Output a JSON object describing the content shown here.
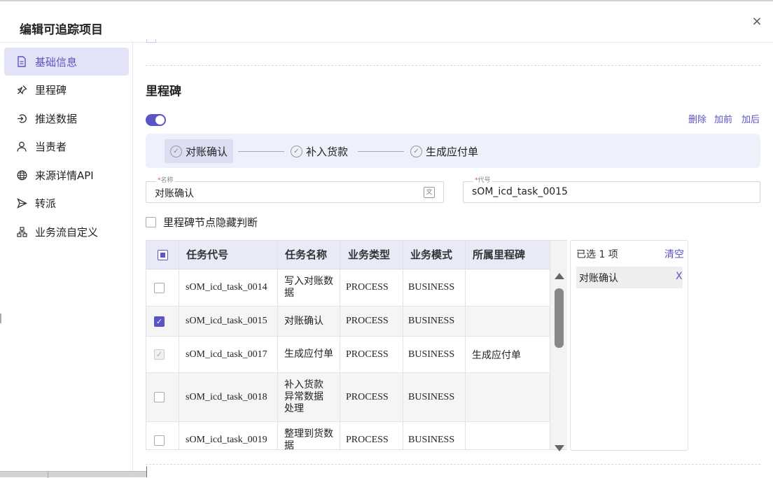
{
  "dialog": {
    "title": "编辑可追踪项目",
    "close_icon": "close-icon",
    "close_label": "×"
  },
  "sidebar": {
    "items": [
      {
        "label": "基础信息",
        "icon": "document-icon",
        "active": true
      },
      {
        "label": "里程碑",
        "icon": "pin-icon",
        "active": false
      },
      {
        "label": "推送数据",
        "icon": "push-arrow-icon",
        "active": false
      },
      {
        "label": "当责者",
        "icon": "user-icon",
        "active": false
      },
      {
        "label": "来源详情API",
        "icon": "globe-icon",
        "active": false
      },
      {
        "label": "转派",
        "icon": "send-icon",
        "active": false
      },
      {
        "label": "业务流自定义",
        "icon": "flow-icon",
        "active": false
      }
    ]
  },
  "milestone": {
    "section_title": "里程碑",
    "toggle_on": true,
    "actions": {
      "delete": "删除",
      "add_before": "加前",
      "add_after": "加后"
    },
    "steps": [
      {
        "label": "对账确认",
        "active": true
      },
      {
        "label": "补入货款",
        "active": false
      },
      {
        "label": "生成应付单",
        "active": false
      }
    ],
    "name_field": {
      "label_req": "*",
      "label": "名称",
      "value": "对账确认"
    },
    "code_field": {
      "label_req": "*",
      "label": "代号",
      "value": "sOM_icd_task_0015"
    },
    "hide_check_label": "里程碑节点隐藏判断"
  },
  "table": {
    "headers": {
      "code": "任务代号",
      "name": "任务名称",
      "btype": "业务类型",
      "bmode": "业务模式",
      "milestone": "所属里程碑"
    },
    "rows": [
      {
        "state": "unchecked",
        "code": "sOM_icd_task_0014",
        "name": "写入对账数据",
        "btype": "PROCESS",
        "bmode": "BUSINESS",
        "milestone": ""
      },
      {
        "state": "checked",
        "code": "sOM_icd_task_0015",
        "name": "对账确认",
        "btype": "PROCESS",
        "bmode": "BUSINESS",
        "milestone": ""
      },
      {
        "state": "disabled",
        "code": "sOM_icd_task_0017",
        "name": "生成应付单",
        "btype": "PROCESS",
        "bmode": "BUSINESS",
        "milestone": "生成应付单"
      },
      {
        "state": "unchecked",
        "code": "sOM_icd_task_0018",
        "name": "补入货款异常数据处理",
        "btype": "PROCESS",
        "bmode": "BUSINESS",
        "milestone": ""
      },
      {
        "state": "unchecked",
        "code": "sOM_icd_task_0019",
        "name": "整理到货数据",
        "btype": "PROCESS",
        "bmode": "BUSINESS",
        "milestone": ""
      }
    ]
  },
  "selected": {
    "count_label": "已选 1 项",
    "clear_label": "清空",
    "tags": [
      {
        "label": "对账确认",
        "remove": "X"
      }
    ]
  },
  "colors": {
    "accent": "#5b54c4",
    "active_bg": "#e3e3f8",
    "steps_bg": "#eef0fb"
  }
}
